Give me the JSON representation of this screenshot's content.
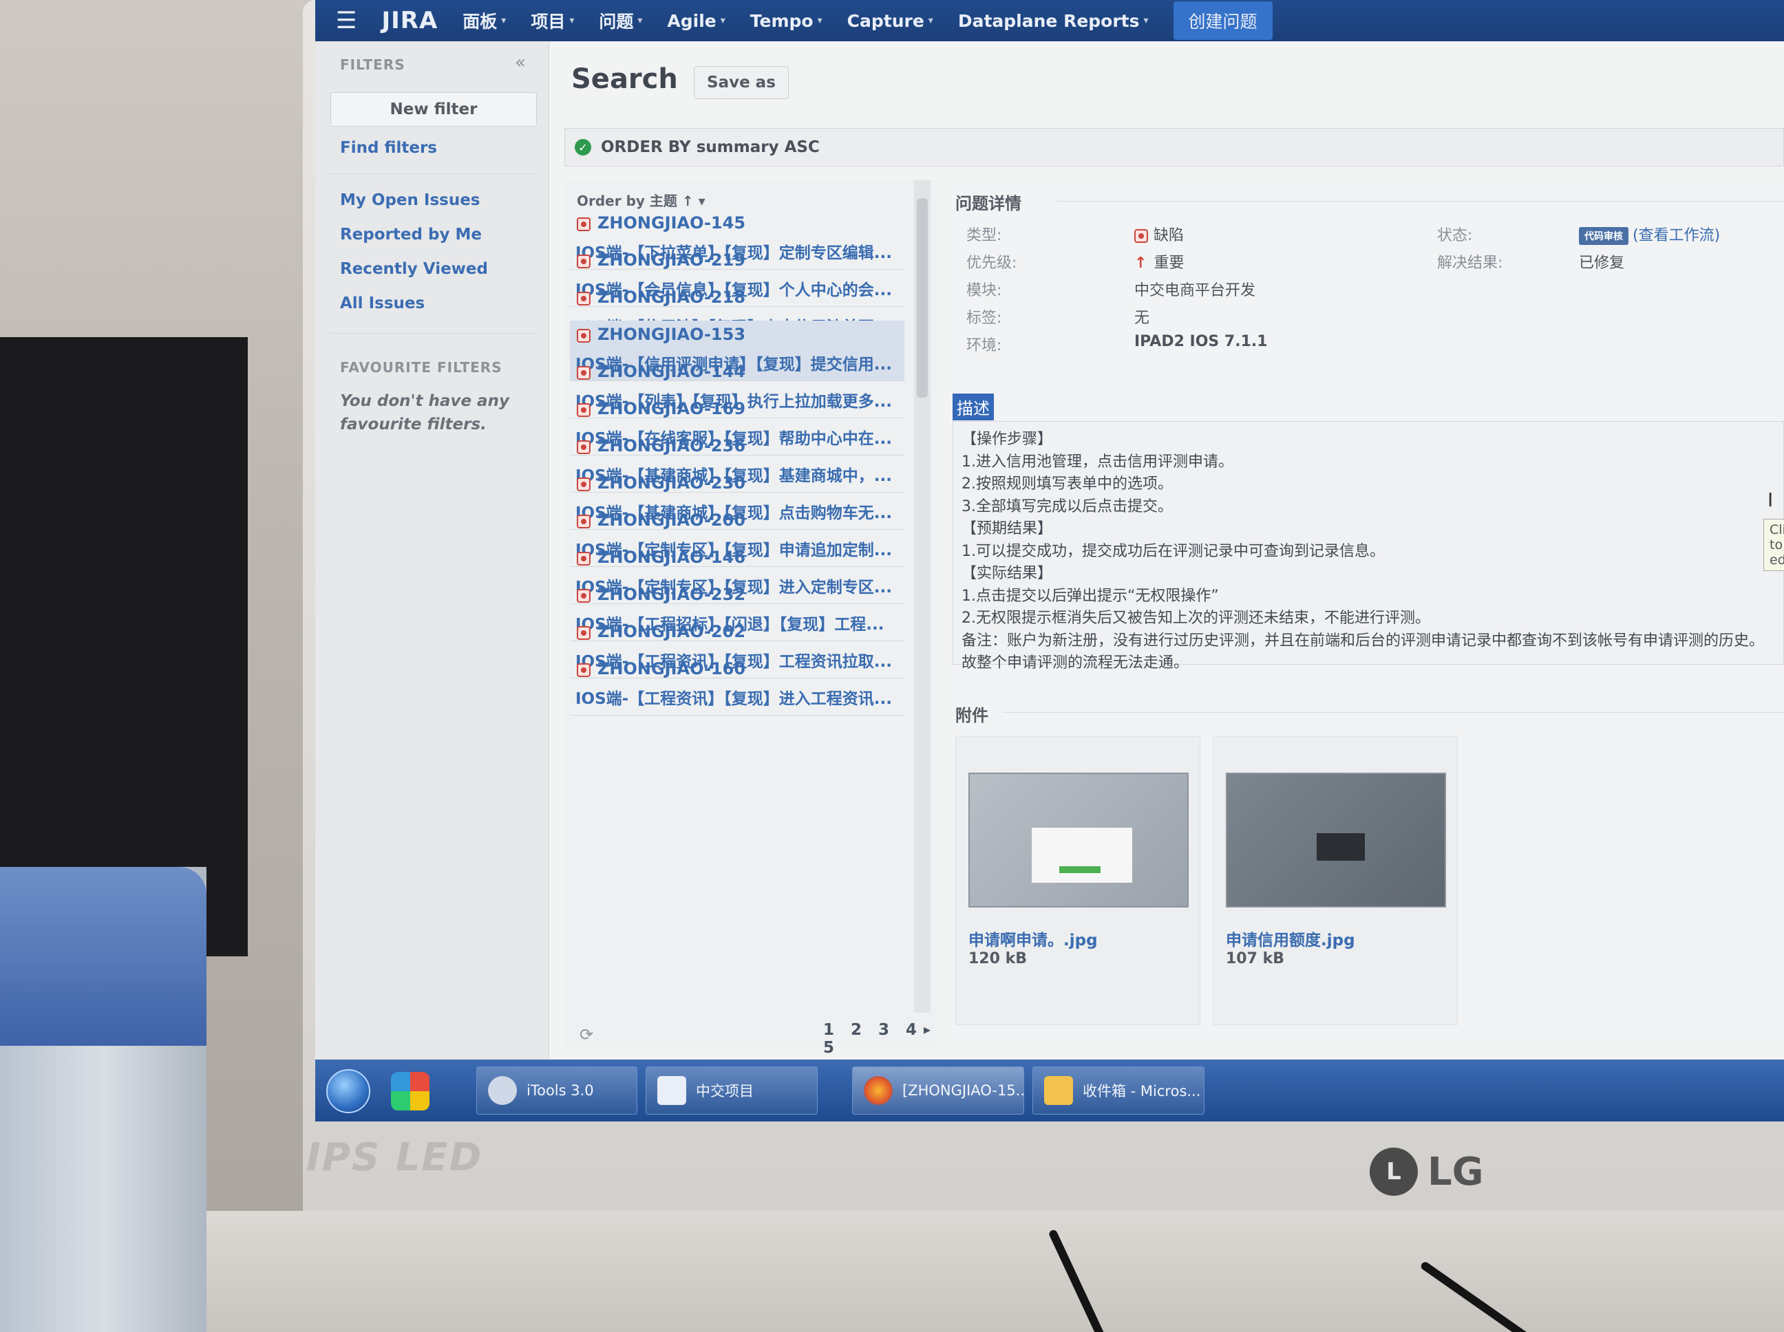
{
  "monitor": {
    "brand_left": "IPS LED",
    "brand_right": "LG",
    "logo_letter": "L"
  },
  "topnav": {
    "menu_icon": "menu-icon",
    "logo": "JIRA",
    "items": [
      "面板",
      "项目",
      "问题",
      "Agile",
      "Tempo",
      "Capture",
      "Dataplane Reports"
    ],
    "create_button": "创建问题"
  },
  "sidebar": {
    "heading": "FILTERS",
    "collapse_icon": "«",
    "new_filter": "New filter",
    "find_filters": "Find filters",
    "links": [
      "My Open Issues",
      "Reported by Me",
      "Recently Viewed",
      "All Issues"
    ],
    "favourites_heading": "FAVOURITE FILTERS",
    "favourites_empty": "You don't have any favourite filters."
  },
  "search": {
    "title": "Search",
    "save_as": "Save as",
    "jql": "ORDER BY summary ASC"
  },
  "issue_list": {
    "order_by": "Order by 主题 ↑",
    "rows": [
      {
        "key": "ZHONGJIAO-145",
        "summary": "IOS端-【下拉菜单】【复现】定制专区编辑..."
      },
      {
        "key": "ZHONGJIAO-219",
        "summary": "IOS端-【会员信息】【复现】个人中心的会..."
      },
      {
        "key": "ZHONGJIAO-218",
        "summary": "IOS端-【信用池】【复现】点击信用池首页..."
      },
      {
        "key": "ZHONGJIAO-153",
        "summary": "IOS端-【信用评测申请】【复现】提交信用..."
      },
      {
        "key": "ZHONGJIAO-144",
        "summary": "IOS端-【列表】【复现】执行上拉加载更多..."
      },
      {
        "key": "ZHONGJIAO-169",
        "summary": "IOS端-【在线客服】【复现】帮助中心中在..."
      },
      {
        "key": "ZHONGJIAO-236",
        "summary": "IOS端-【基建商城】【复现】基建商城中，..."
      },
      {
        "key": "ZHONGJIAO-230",
        "summary": "IOS端-【基建商城】【复现】点击购物车无..."
      },
      {
        "key": "ZHONGJIAO-200",
        "summary": "IOS端-【定制专区】【复现】申请追加定制..."
      },
      {
        "key": "ZHONGJIAO-146",
        "summary": "IOS端-【定制专区】【复现】进入定制专区..."
      },
      {
        "key": "ZHONGJIAO-232",
        "summary": "IOS端-【工程招标】【闪退】【复现】工程..."
      },
      {
        "key": "ZHONGJIAO-202",
        "summary": "IOS端-【工程资讯】【复现】工程资讯拉取..."
      },
      {
        "key": "ZHONGJIAO-160",
        "summary": "IOS端-【工程资讯】【复现】进入工程资讯..."
      }
    ],
    "selected_index": 3,
    "pages": "1 2 3 4 5",
    "next": "▸"
  },
  "detail": {
    "section_title": "问题详情",
    "fields": {
      "type_label": "类型:",
      "type_value": "缺陷",
      "priority_label": "优先级:",
      "priority_value": "重要",
      "priority_icon": "↑",
      "component_label": "模块:",
      "component_value": "中交电商平台开发",
      "labels_label": "标签:",
      "labels_value": "无",
      "env_label": "环境:",
      "env_value": "IPAD2 IOS 7.1.1",
      "status_label": "状态:",
      "status_value": "代码审核",
      "status_link": "(查看工作流)",
      "resolution_label": "解决结果:",
      "resolution_value": "已修复"
    },
    "description_title": "描述",
    "description_lines": [
      "【操作步骤】",
      "1.进入信用池管理，点击信用评测申请。",
      "2.按照规则填写表单中的选项。",
      "3.全部填写完成以后点击提交。",
      "【预期结果】",
      "1.可以提交成功，提交成功后在评测记录中可查询到记录信息。",
      "【实际结果】",
      "1.点击提交以后弹出提示“无权限操作”",
      "2.无权限提示框消失后又被告知上次的评测还未结束，不能进行评测。",
      "备注：账户为新注册，没有进行过历史评测，并且在前端和后台的评测申请记录中都查询不到该帐号有申请评测的历史。",
      "故整个申请评测的流程无法走通。"
    ],
    "click_to_edit": "Click to edit",
    "attachments_title": "附件",
    "attachments": [
      {
        "name": "申请啊申请。.jpg",
        "size": "120 kB"
      },
      {
        "name": "申请信用额度.jpg",
        "size": "107 kB"
      }
    ]
  },
  "taskbar": {
    "items": [
      "iTools 3.0",
      "中交项目",
      "[ZHONGJIAO-15...",
      "收件箱 - Micros..."
    ]
  }
}
